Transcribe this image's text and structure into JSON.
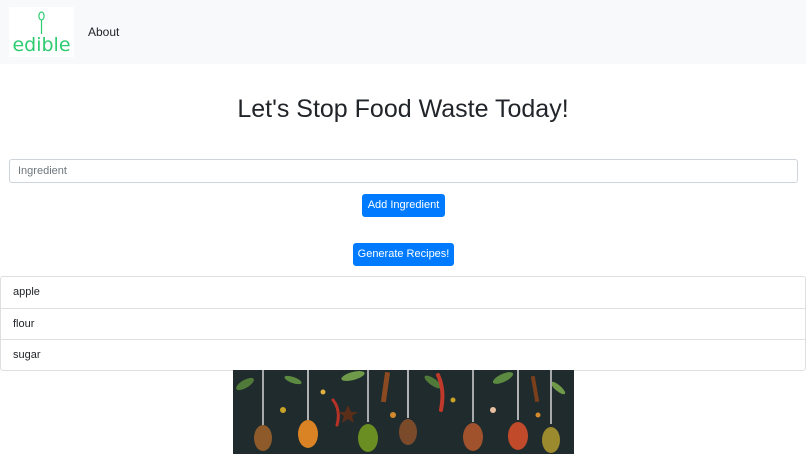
{
  "navbar": {
    "logo_text": "edible",
    "links": [
      {
        "label": "About"
      }
    ]
  },
  "main": {
    "title": "Let's Stop Food Waste Today!",
    "ingredient_input": {
      "placeholder": "Ingredient",
      "value": ""
    },
    "add_button_label": "Add Ingredient",
    "generate_button_label": "Generate Recipes!",
    "ingredients": [
      "apple",
      "flour",
      "sugar"
    ]
  },
  "colors": {
    "brand_green": "#2ecc71",
    "primary_button": "#007bff",
    "navbar_bg": "#f8f9fa"
  },
  "icons": {
    "logo_mark": "spoon-icon",
    "food_image": "spices-on-spoons-photo"
  }
}
